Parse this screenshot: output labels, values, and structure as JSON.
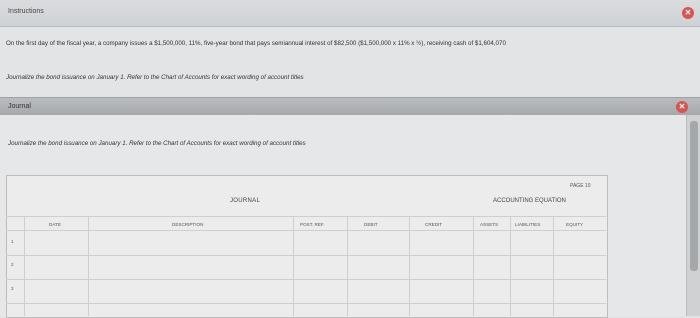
{
  "header": {
    "title": "Instructions"
  },
  "instructions": {
    "body": "On the first day of the fiscal year, a company issues a $1,500,000, 11%, five-year bond that pays semiannual interest of $82,500 ($1,500,000 x 11% x ½), receiving cash of $1,604,070",
    "task": "Journalize the bond issuance on January 1. Refer to the Chart of Accounts for exact wording of account titles"
  },
  "journal_tab": {
    "label": "Journal",
    "text": "Journalize the bond issuance on January 1. Refer to the Chart of Accounts for exact wording of account titles"
  },
  "sheet": {
    "page": "PAGE 10",
    "title": "JOURNAL",
    "accounting_equation": "ACCOUNTING EQUATION",
    "columns": {
      "date": "DATE",
      "description": "DESCRIPTION",
      "post_ref": "POST. REF.",
      "debit": "DEBIT",
      "credit": "CREDIT",
      "assets": "ASSETS",
      "liabilities": "LIABILITIES",
      "equity": "EQUITY"
    },
    "rows": [
      "1",
      "2",
      "3"
    ]
  },
  "icons": {
    "close": "close-icon"
  },
  "colors": {
    "close": "#d9534f"
  }
}
